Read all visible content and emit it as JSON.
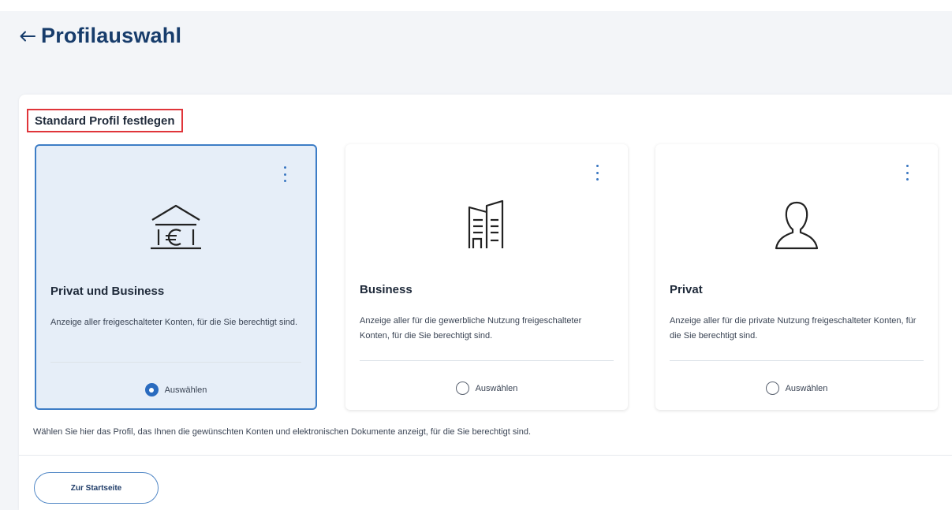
{
  "header": {
    "title": "Profilauswahl",
    "back_icon": "arrow-left-icon"
  },
  "section": {
    "title": "Standard Profil festlegen"
  },
  "cards": [
    {
      "icon": "bank-euro-icon",
      "title": "Privat und Business",
      "description": "Anzeige aller freigeschalteter Konten, für die Sie berechtigt sind.",
      "radio_label": "Auswählen",
      "selected": true
    },
    {
      "icon": "office-building-icon",
      "title": "Business",
      "description": "Anzeige aller für die gewerbliche Nutzung freigeschalteter Konten, für die Sie berechtigt sind.",
      "radio_label": "Auswählen",
      "selected": false
    },
    {
      "icon": "person-icon",
      "title": "Privat",
      "description": "Anzeige aller für die private Nutzung freigeschalteter Konten, für die Sie berechtigt sind.",
      "radio_label": "Auswählen",
      "selected": false
    }
  ],
  "hint": "Wählen Sie hier das Profil, das Ihnen die gewünschten Konten und elektronischen Dokumente anzeigt, für die Sie berechtigt sind.",
  "footer": {
    "start_button_label": "Zur Startseite"
  },
  "colors": {
    "title": "#173c6b",
    "accent": "#2a6bbf",
    "selected_card_bg": "#e6eef8",
    "highlight_border": "#e0353a"
  }
}
